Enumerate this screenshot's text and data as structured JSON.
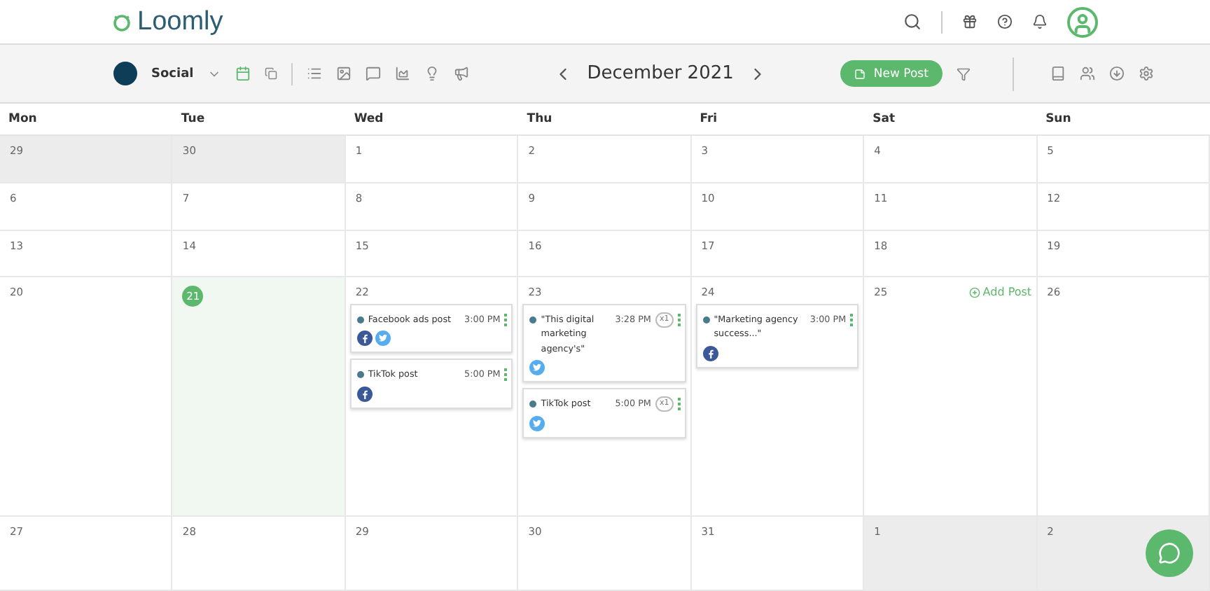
{
  "header": {
    "logo": "Loomly"
  },
  "toolbar": {
    "calendar_name": "Social",
    "month": "December 2021",
    "new_post": "New Post"
  },
  "weekdays": [
    "Mon",
    "Tue",
    "Wed",
    "Thu",
    "Fri",
    "Sat",
    "Sun"
  ],
  "weeks": [
    [
      {
        "day": "29",
        "kind": "other"
      },
      {
        "day": "30",
        "kind": "other"
      },
      {
        "day": "1",
        "kind": "normal"
      },
      {
        "day": "2",
        "kind": "normal"
      },
      {
        "day": "3",
        "kind": "normal"
      },
      {
        "day": "4",
        "kind": "normal"
      },
      {
        "day": "5",
        "kind": "normal"
      }
    ],
    [
      {
        "day": "6",
        "kind": "normal"
      },
      {
        "day": "7",
        "kind": "normal"
      },
      {
        "day": "8",
        "kind": "normal"
      },
      {
        "day": "9",
        "kind": "normal"
      },
      {
        "day": "10",
        "kind": "normal"
      },
      {
        "day": "11",
        "kind": "normal"
      },
      {
        "day": "12",
        "kind": "normal"
      }
    ],
    [
      {
        "day": "13",
        "kind": "normal"
      },
      {
        "day": "14",
        "kind": "normal"
      },
      {
        "day": "15",
        "kind": "normal"
      },
      {
        "day": "16",
        "kind": "normal"
      },
      {
        "day": "17",
        "kind": "normal"
      },
      {
        "day": "18",
        "kind": "normal"
      },
      {
        "day": "19",
        "kind": "normal"
      }
    ],
    [
      {
        "day": "20",
        "kind": "normal"
      },
      {
        "day": "21",
        "kind": "today"
      },
      {
        "day": "22",
        "kind": "normal",
        "posts": [
          {
            "title": "Facebook ads post",
            "time": "3:00 PM",
            "color": "#4a7a8c",
            "networks": [
              {
                "kind": "facebook"
              },
              {
                "kind": "twitter"
              }
            ]
          },
          {
            "title": "TikTok post",
            "time": "5:00 PM",
            "color": "#4a7a8c",
            "networks": [
              {
                "kind": "facebook"
              }
            ]
          }
        ]
      },
      {
        "day": "23",
        "kind": "normal",
        "posts": [
          {
            "title": "\"This digital marketing agency's\"",
            "time": "3:28 PM",
            "badge": "x1",
            "color": "#4a7a8c",
            "networks": [
              {
                "kind": "twitter"
              }
            ]
          },
          {
            "title": "TikTok post",
            "time": "5:00 PM",
            "badge": "x1",
            "color": "#4a7a8c",
            "networks": [
              {
                "kind": "twitter"
              }
            ]
          }
        ]
      },
      {
        "day": "24",
        "kind": "normal",
        "posts": [
          {
            "title": "\"Marketing agency success...\"",
            "time": "3:00 PM",
            "color": "#4a7a8c",
            "networks": [
              {
                "kind": "facebook"
              }
            ]
          }
        ]
      },
      {
        "day": "25",
        "kind": "normal",
        "add_post": "Add Post"
      },
      {
        "day": "26",
        "kind": "normal"
      }
    ],
    [
      {
        "day": "27",
        "kind": "normal"
      },
      {
        "day": "28",
        "kind": "normal"
      },
      {
        "day": "29",
        "kind": "normal"
      },
      {
        "day": "30",
        "kind": "normal"
      },
      {
        "day": "31",
        "kind": "normal"
      },
      {
        "day": "1",
        "kind": "other"
      },
      {
        "day": "2",
        "kind": "other"
      }
    ]
  ]
}
